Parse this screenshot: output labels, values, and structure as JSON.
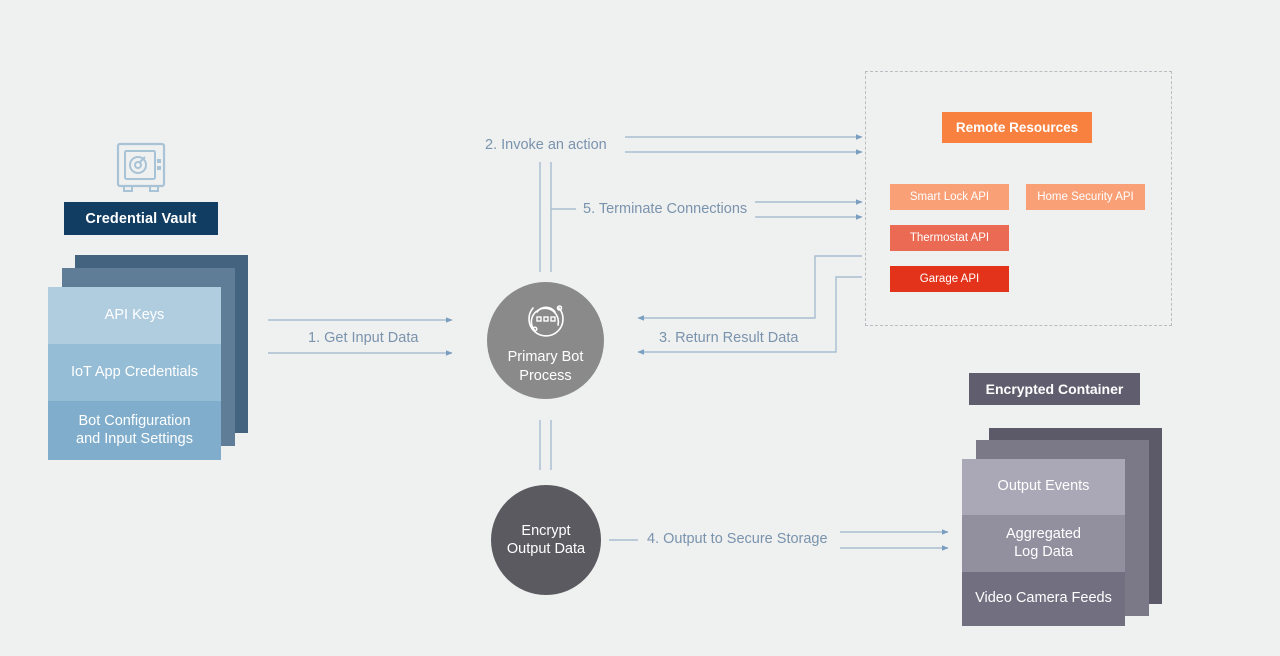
{
  "diagram": {
    "title_nodes": {
      "credential_vault": "Credential Vault",
      "encrypted_container": "Encrypted Container"
    },
    "input_stack": {
      "rows": [
        "API Keys",
        "IoT App Credentials",
        "Bot Configuration\nand Input Settings"
      ],
      "bot_config_line1": "Bot Configuration",
      "bot_config_line2": "and Input Settings"
    },
    "process": {
      "primary_bot_line1": "Primary Bot",
      "primary_bot_line2": "Process",
      "encrypt_line1": "Encrypt",
      "encrypt_line2": "Output Data"
    },
    "remote": {
      "header": "Remote Resources",
      "apis": [
        {
          "label": "Smart Lock API",
          "color": "#f9a077"
        },
        {
          "label": "Home Security API",
          "color": "#f9a077"
        },
        {
          "label": "Thermostat API",
          "color": "#ea6a53"
        },
        {
          "label": "Garage API",
          "color": "#e3331a"
        }
      ]
    },
    "output_stack": {
      "rows": [
        "Output Events",
        "Aggregated\nLog Data",
        "Video Camera Feeds"
      ],
      "aggregated_line1": "Aggregated",
      "aggregated_line2": "Log Data",
      "output_events": "Output Events",
      "video_feeds": "Video Camera Feeds"
    },
    "steps": {
      "step1": "1. Get Input Data",
      "step2": "2. Invoke an action",
      "step3": "3. Return Result Data",
      "step4": "4. Output to Secure Storage",
      "step5": "5. Terminate Connections"
    },
    "colors": {
      "background": "#eff0f0",
      "vault_navy": "#123d63",
      "connector_blue": "#a8bdd0",
      "label_blue": "#7a93ad",
      "bot_gray": "#8a8a8a",
      "encrypt_gray": "#5a5a60",
      "accent_orange": "#f8813f",
      "container_purple": "#605e6e"
    },
    "icons": {
      "vault": "safe-vault-icon",
      "bot": "bot-process-icon"
    }
  }
}
